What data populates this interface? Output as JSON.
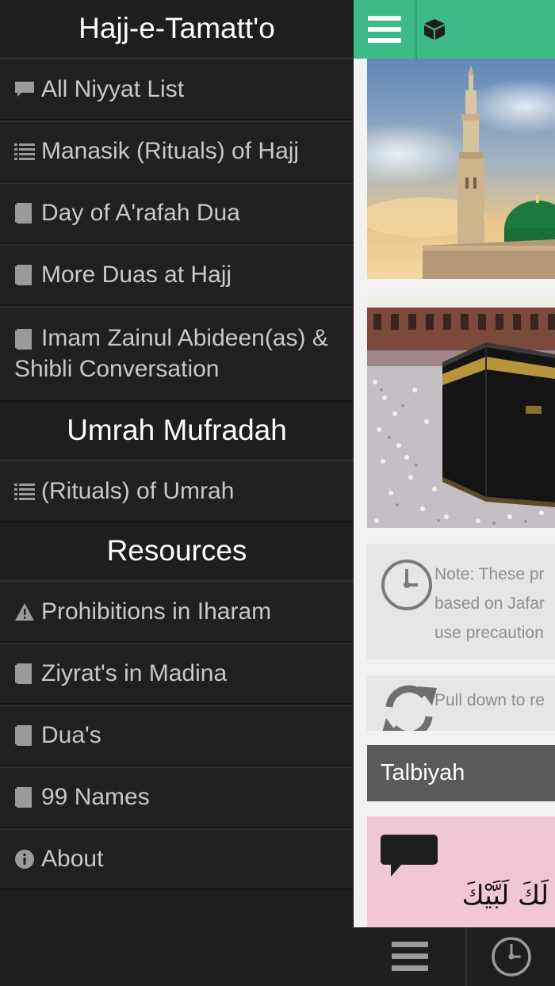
{
  "drawer": {
    "hajj_title": "Hajj-e-Tamatt'o",
    "hajj_items": [
      {
        "label": "All Niyyat List",
        "icon": "comment-icon"
      },
      {
        "label": "Manasik (Rituals) of Hajj",
        "icon": "list-icon"
      },
      {
        "label": "Day of A'rafah Dua",
        "icon": "book-icon"
      },
      {
        "label": "More Duas at Hajj",
        "icon": "book-icon"
      },
      {
        "label": "Imam Zainul Abideen(as) & Shibli Conversation",
        "icon": "book-icon"
      }
    ],
    "umrah_title": "Umrah Mufradah",
    "umrah_items": [
      {
        "label": "(Rituals) of Umrah",
        "icon": "list-icon"
      }
    ],
    "resources_title": "Resources",
    "resources_items": [
      {
        "label": "Prohibitions in Iharam",
        "icon": "warning-icon"
      },
      {
        "label": "Ziyrat's in Madina",
        "icon": "book-icon"
      },
      {
        "label": "Dua's",
        "icon": "book-icon"
      },
      {
        "label": "99 Names",
        "icon": "book-icon"
      },
      {
        "label": "About",
        "icon": "info-icon"
      }
    ]
  },
  "main": {
    "note_line1": "Note: These pr",
    "note_line2": "based on Jafar",
    "note_line3": "use precaution",
    "pull_text": "Pull down to re",
    "talbiyah_title": "Talbiyah",
    "arabic_text": "لَكَ لَبَّيْكَ"
  },
  "colors": {
    "accent": "#3dba88",
    "drawer_bg": "#1e1e1e",
    "talbiyah_bar": "#5a5a5a",
    "pink_card": "#f0c7d3"
  }
}
